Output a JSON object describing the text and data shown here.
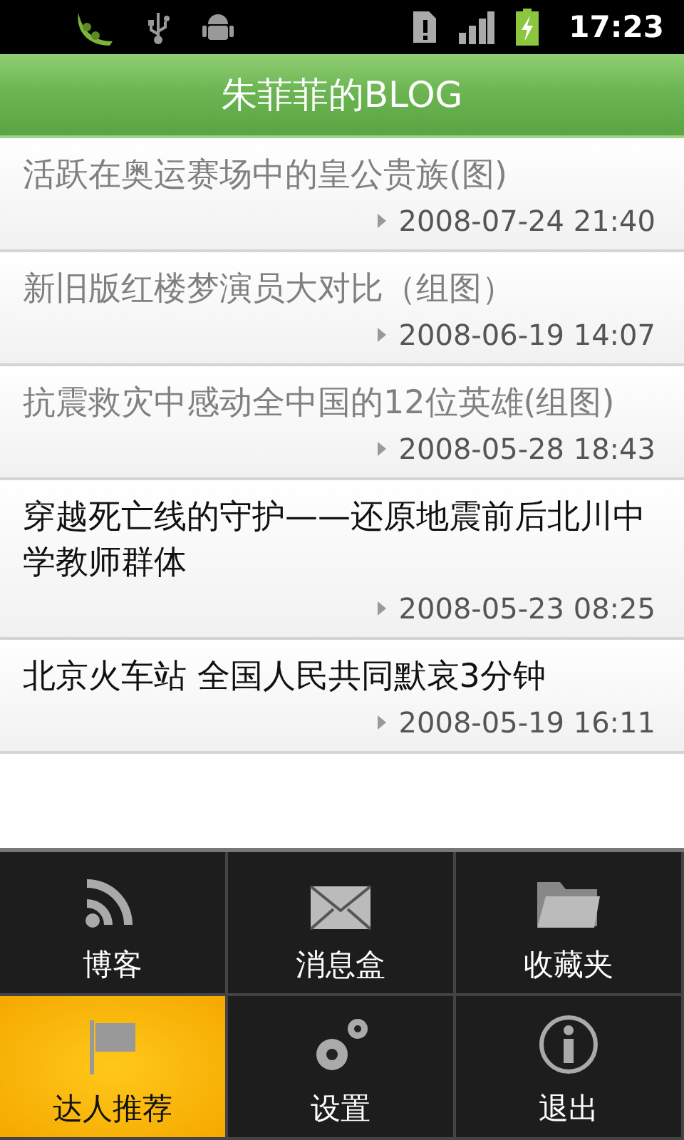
{
  "status_bar": {
    "time": "17:23"
  },
  "title_bar": {
    "title": "朱菲菲的BLOG"
  },
  "posts": [
    {
      "title": "活跃在奥运赛场中的皇公贵族(图)",
      "date": "2008-07-24 21:40",
      "read": true
    },
    {
      "title": "新旧版红楼梦演员大对比（组图）",
      "date": "2008-06-19 14:07",
      "read": true
    },
    {
      "title": "抗震救灾中感动全中国的12位英雄(组图)",
      "date": "2008-05-28 18:43",
      "read": true
    },
    {
      "title": "穿越死亡线的守护——还原地震前后北川中学教师群体",
      "date": "2008-05-23 08:25",
      "read": false
    },
    {
      "title": "北京火车站 全国人民共同默哀3分钟",
      "date": "2008-05-19 16:11",
      "read": false
    }
  ],
  "options_menu": [
    {
      "label": "博客",
      "selected": false
    },
    {
      "label": "消息盒",
      "selected": false
    },
    {
      "label": "收藏夹",
      "selected": false
    },
    {
      "label": "达人推荐",
      "selected": true
    },
    {
      "label": "设置",
      "selected": false
    },
    {
      "label": "退出",
      "selected": false
    }
  ]
}
